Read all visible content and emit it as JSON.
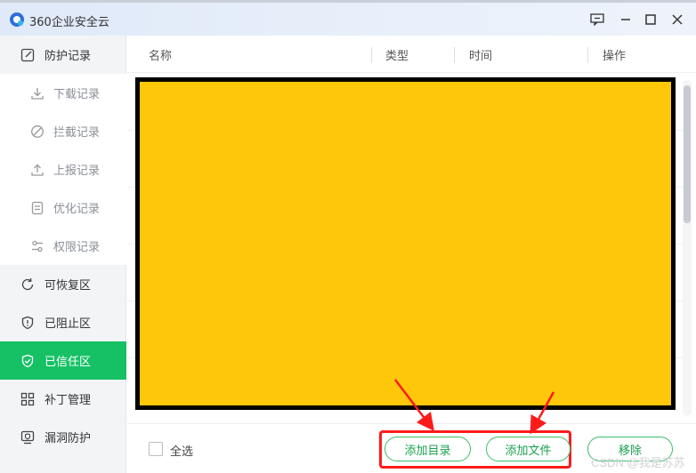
{
  "window": {
    "title": "360企业安全云",
    "controls": [
      "feedback-icon",
      "minimize-icon",
      "maximize-icon",
      "close-icon"
    ]
  },
  "sidebar": {
    "items": [
      {
        "label": "防护记录",
        "icon": "edit-icon",
        "kind": "main"
      },
      {
        "label": "下载记录",
        "icon": "download-icon",
        "kind": "sub"
      },
      {
        "label": "拦截记录",
        "icon": "block-icon",
        "kind": "sub"
      },
      {
        "label": "上报记录",
        "icon": "upload-icon",
        "kind": "sub"
      },
      {
        "label": "优化记录",
        "icon": "document-icon",
        "kind": "sub"
      },
      {
        "label": "权限记录",
        "icon": "sliders-icon",
        "kind": "sub"
      },
      {
        "label": "可恢复区",
        "icon": "restore-icon",
        "kind": "main"
      },
      {
        "label": "已阻止区",
        "icon": "shield-alert-icon",
        "kind": "main"
      },
      {
        "label": "已信任区",
        "icon": "shield-check-icon",
        "kind": "active"
      },
      {
        "label": "补丁管理",
        "icon": "grid-icon",
        "kind": "main"
      },
      {
        "label": "漏洞防护",
        "icon": "screen-shield-icon",
        "kind": "main"
      }
    ]
  },
  "table": {
    "columns": [
      "名称",
      "类型",
      "时间",
      "操作"
    ]
  },
  "footer": {
    "select_all": "全选",
    "add_directory": "添加目录",
    "add_file": "添加文件",
    "remove": "移除"
  },
  "colors": {
    "accent": "#16c165",
    "overlay": "#ffc70a",
    "highlight": "#ff1a1a"
  },
  "watermark": "CSDN @我是苏苏"
}
